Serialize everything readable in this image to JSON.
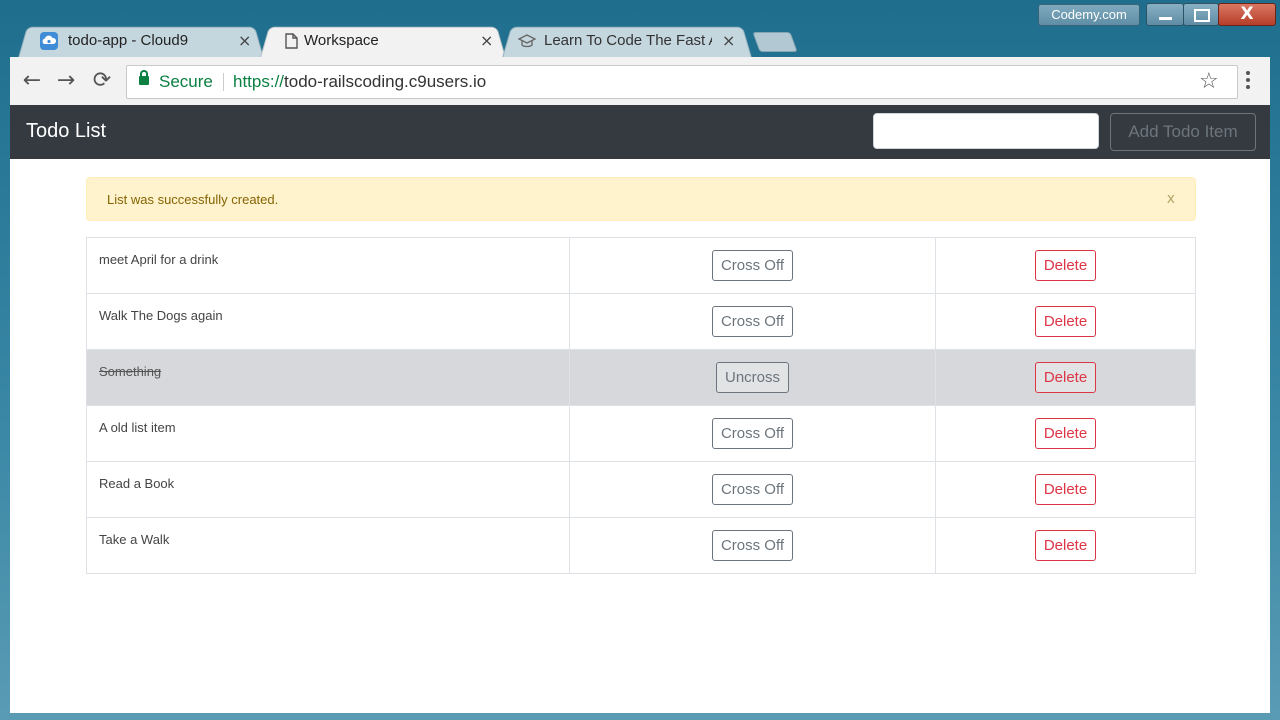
{
  "window": {
    "watermark": "Codemy.com",
    "minimize_icon": "minimize-icon",
    "maximize_icon": "maximize-icon",
    "close_glyph": "X"
  },
  "tabs": [
    {
      "label": "todo-app - Cloud9",
      "icon": "cloud9-icon",
      "active": false,
      "close": "×"
    },
    {
      "label": "Workspace",
      "icon": "page-icon",
      "active": true,
      "close": "×"
    },
    {
      "label": "Learn To Code The Fast A",
      "icon": "graduation-cap-icon",
      "active": false,
      "close": "×"
    }
  ],
  "toolbar": {
    "back": "←",
    "forward": "→",
    "reload": "⟳",
    "secure_label": "Secure",
    "url_scheme": "https://",
    "url_host": "todo-railscoding.c9users.io",
    "bookmark": "☆"
  },
  "app": {
    "brand": "Todo List",
    "input_value": "",
    "add_button": "Add Todo Item",
    "navbar_color": "#343a40"
  },
  "alert": {
    "message": "List was successfully created.",
    "dismiss": "x"
  },
  "todos": [
    {
      "text": "meet April for a drink",
      "action": "Cross Off",
      "delete": "Delete",
      "completed": false
    },
    {
      "text": "Walk The Dogs again",
      "action": "Cross Off",
      "delete": "Delete",
      "completed": false
    },
    {
      "text": "Something",
      "action": "Uncross",
      "delete": "Delete",
      "completed": true
    },
    {
      "text": "A old list item",
      "action": "Cross Off",
      "delete": "Delete",
      "completed": false
    },
    {
      "text": "Read a Book",
      "action": "Cross Off",
      "delete": "Delete",
      "completed": false
    },
    {
      "text": "Take a Walk",
      "action": "Cross Off",
      "delete": "Delete",
      "completed": false
    }
  ]
}
